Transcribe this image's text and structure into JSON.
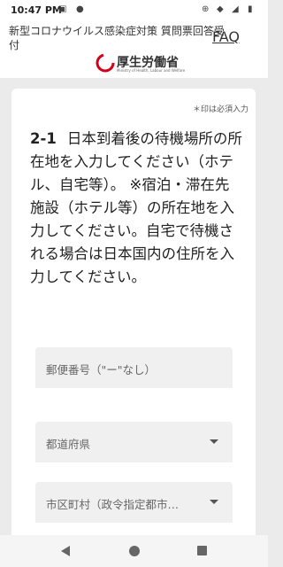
{
  "status_bar": {
    "time": "10:47 PM",
    "icons": [
      "image-icon",
      "dot-icon",
      "battery-saver-icon",
      "wifi-icon",
      "signal-icon",
      "battery-icon"
    ]
  },
  "header": {
    "title": "新型コロナウイルス感染症対策 質問票回答受付",
    "faq_label": "FAQ",
    "logo_name": "厚生労働省",
    "logo_sub": "Ministry of Health, Labour and Welfare"
  },
  "form": {
    "required_note": "＊印は必須入力",
    "question_number": "2-1",
    "question_text": "日本到着後の待機場所の所在地を入力してください（ホテル、自宅等）。 ※宿泊・滞在先施設（ホテル等）の所在地を入力してください。自宅で待機される場合は日本国内の住所を入力してください。",
    "postal_placeholder": "郵便番号（\"ー\"なし）",
    "prefecture_label": "都道府県",
    "city_label": "市区町村（政令指定都市…"
  },
  "colors": {
    "page_bg": "#ebebeb",
    "card_bg": "#ffffff",
    "field_bg": "#f0f0f0",
    "logo_red": "#d0021b"
  }
}
